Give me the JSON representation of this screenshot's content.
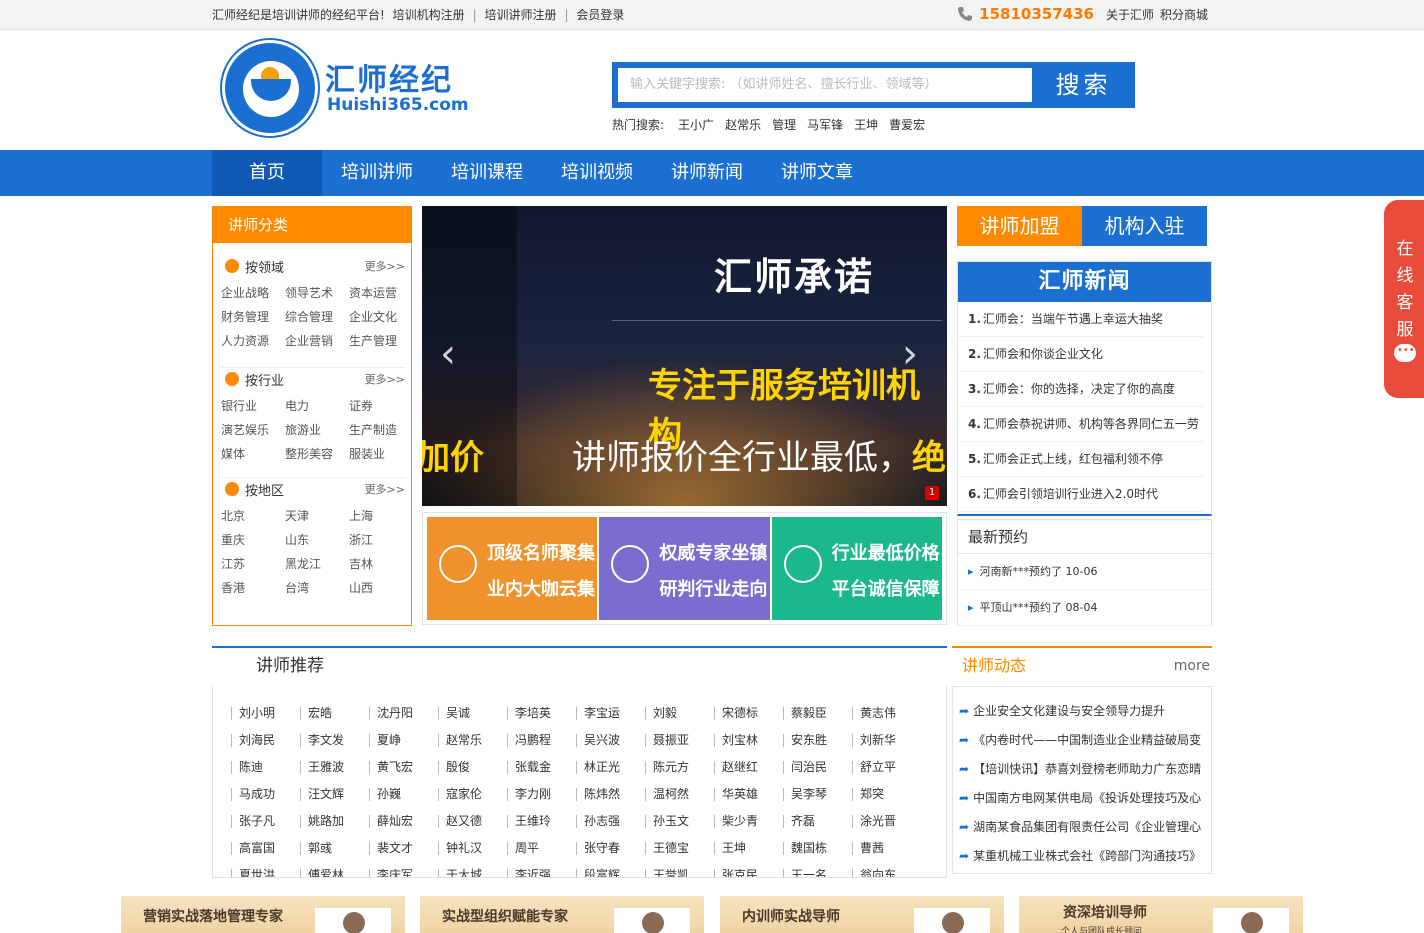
{
  "topbar": {
    "slogan": "汇师经纪是培训讲师的经纪平台!",
    "links": [
      "培训机构注册",
      "培训讲师注册",
      "会员登录"
    ],
    "phone": "15810357436",
    "right_links": [
      "关于汇师",
      "积分商城"
    ]
  },
  "header": {
    "brand": "汇师经纪",
    "domain": "Huishi365.com",
    "search_placeholder": "输入关键字搜索: （如讲师姓名、擅长行业、领域等）",
    "search_button": "搜索",
    "hot_label": "热门搜索:",
    "hot_keywords": [
      "王小广",
      "赵常乐",
      "管理",
      "马军锋",
      "王坤",
      "曹爱宏"
    ]
  },
  "nav": [
    "首页",
    "培训讲师",
    "培训课程",
    "培训视频",
    "讲师新闻",
    "讲师文章"
  ],
  "category": {
    "title": "讲师分类",
    "more": "更多>>",
    "groups": [
      {
        "title": "按领域",
        "items": [
          "企业战略",
          "领导艺术",
          "资本运营",
          "财务管理",
          "综合管理",
          "企业文化",
          "人力资源",
          "企业营销",
          "生产管理"
        ]
      },
      {
        "title": "按行业",
        "items": [
          "银行业",
          "电力",
          "证券",
          "演艺娱乐",
          "旅游业",
          "生产制造",
          "媒体",
          "整形美容",
          "服装业"
        ]
      },
      {
        "title": "按地区",
        "items": [
          "北京",
          "天津",
          "上海",
          "重庆",
          "山东",
          "浙江",
          "江苏",
          "黑龙江",
          "吉林",
          "香港",
          "台湾",
          "山西"
        ]
      }
    ]
  },
  "banner": {
    "title": "汇师承诺",
    "line2": "专注于服务培训机构",
    "line3a": "讲师报价全行业最低，",
    "line3b": "绝不加",
    "left_fragment": "加价",
    "page_indicator": "1"
  },
  "tiles": [
    {
      "l1": "顶级名师聚集",
      "l2": "业内大咖云集",
      "color": "#f0922b"
    },
    {
      "l1": "权威专家坐镇",
      "l2": "研判行业走向",
      "color": "#7b6ccf"
    },
    {
      "l1": "行业最低价格",
      "l2": "平台诚信保障",
      "color": "#1bb88b"
    }
  ],
  "join": {
    "a": "讲师加盟",
    "b": "机构入驻"
  },
  "news": {
    "title": "汇师新闻",
    "items": [
      {
        "n": "1.",
        "t": "汇师会：当端午节遇上幸运大抽奖"
      },
      {
        "n": "2.",
        "t": "汇师会和你谈企业文化"
      },
      {
        "n": "3.",
        "t": "汇师会：你的选择，决定了你的高度"
      },
      {
        "n": "4.",
        "t": "汇师会恭祝讲师、机构等各界同仁五一劳"
      },
      {
        "n": "5.",
        "t": "汇师会正式上线，红包福利领不停"
      },
      {
        "n": "6.",
        "t": "汇师会引领培训行业进入2.0时代"
      }
    ]
  },
  "reservations": {
    "title": "最新预约",
    "items": [
      "河南新***预约了 10-06",
      "平顶山***预约了 08-04"
    ]
  },
  "recommend": {
    "title": "讲师推荐",
    "names": [
      "刘小明",
      "宏皓",
      "沈丹阳",
      "吴诚",
      "李培英",
      "李宝运",
      "刘毅",
      "宋德标",
      "蔡毅臣",
      "黄志伟",
      "刘海民",
      "李文发",
      "夏峥",
      "赵常乐",
      "冯鹏程",
      "吴兴波",
      "聂振亚",
      "刘宝林",
      "安东胜",
      "刘新华",
      "陈迪",
      "王雅波",
      "黄飞宏",
      "殷俊",
      "张载金",
      "林正光",
      "陈元方",
      "赵继红",
      "闫治民",
      "舒立平",
      "马成功",
      "汪文辉",
      "孙巍",
      "寇家伦",
      "李力刚",
      "陈炜然",
      "温柯然",
      "华英雄",
      "吴李琴",
      "郑突",
      "张子凡",
      "姚路加",
      "薛灿宏",
      "赵又德",
      "王维玲",
      "孙志强",
      "孙玉文",
      "柴少青",
      "齐磊",
      "涂光晋",
      "高富国",
      "郭彧",
      "裴文才",
      "钟礼汉",
      "周平",
      "张守春",
      "王德宝",
      "王坤",
      "魏国栋",
      "曹茜",
      "夏世洪",
      "傅爱林",
      "李庆军",
      "于大城",
      "李近强",
      "段富辉",
      "王誉凯",
      "张克民",
      "王一名",
      "翁向东"
    ]
  },
  "dynamics": {
    "title": "讲师动态",
    "more": "more",
    "items": [
      "企业安全文化建设与安全领导力提升",
      "《内卷时代——中国制造业企业精益破局变",
      "【培训快讯】恭喜刘登榜老师助力广东恋晴",
      "中国南方电网某供电局《投诉处理技巧及心",
      "湖南某食品集团有限责任公司《企业管理心",
      "某重机械工业株式会社《跨部门沟通技巧》"
    ]
  },
  "ads": [
    {
      "t": "营销实战落地管理专家",
      "t2": ""
    },
    {
      "t": "实战型组织赋能专家",
      "t2": ""
    },
    {
      "t": "内训师实战导师",
      "t2": ""
    },
    {
      "t": "资深培训导师",
      "t2": "个人与团队成长顾问"
    }
  ],
  "kefu": {
    "text": "在线客服"
  }
}
